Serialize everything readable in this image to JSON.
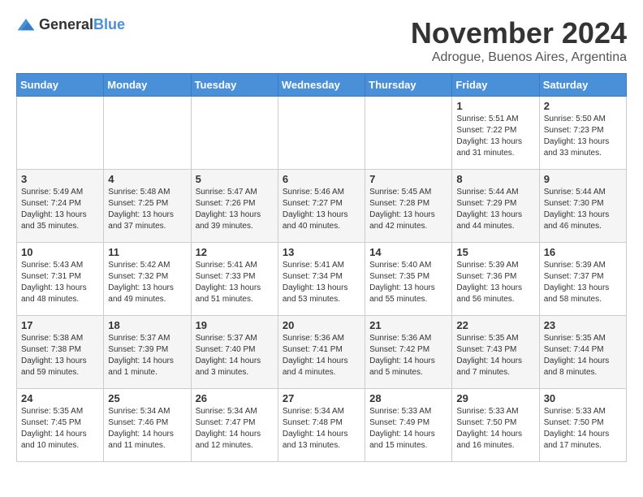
{
  "logo": {
    "general": "General",
    "blue": "Blue"
  },
  "title": {
    "month": "November 2024",
    "location": "Adrogue, Buenos Aires, Argentina"
  },
  "weekdays": [
    "Sunday",
    "Monday",
    "Tuesday",
    "Wednesday",
    "Thursday",
    "Friday",
    "Saturday"
  ],
  "weeks": [
    [
      {
        "day": "",
        "info": ""
      },
      {
        "day": "",
        "info": ""
      },
      {
        "day": "",
        "info": ""
      },
      {
        "day": "",
        "info": ""
      },
      {
        "day": "",
        "info": ""
      },
      {
        "day": "1",
        "info": "Sunrise: 5:51 AM\nSunset: 7:22 PM\nDaylight: 13 hours\nand 31 minutes."
      },
      {
        "day": "2",
        "info": "Sunrise: 5:50 AM\nSunset: 7:23 PM\nDaylight: 13 hours\nand 33 minutes."
      }
    ],
    [
      {
        "day": "3",
        "info": "Sunrise: 5:49 AM\nSunset: 7:24 PM\nDaylight: 13 hours\nand 35 minutes."
      },
      {
        "day": "4",
        "info": "Sunrise: 5:48 AM\nSunset: 7:25 PM\nDaylight: 13 hours\nand 37 minutes."
      },
      {
        "day": "5",
        "info": "Sunrise: 5:47 AM\nSunset: 7:26 PM\nDaylight: 13 hours\nand 39 minutes."
      },
      {
        "day": "6",
        "info": "Sunrise: 5:46 AM\nSunset: 7:27 PM\nDaylight: 13 hours\nand 40 minutes."
      },
      {
        "day": "7",
        "info": "Sunrise: 5:45 AM\nSunset: 7:28 PM\nDaylight: 13 hours\nand 42 minutes."
      },
      {
        "day": "8",
        "info": "Sunrise: 5:44 AM\nSunset: 7:29 PM\nDaylight: 13 hours\nand 44 minutes."
      },
      {
        "day": "9",
        "info": "Sunrise: 5:44 AM\nSunset: 7:30 PM\nDaylight: 13 hours\nand 46 minutes."
      }
    ],
    [
      {
        "day": "10",
        "info": "Sunrise: 5:43 AM\nSunset: 7:31 PM\nDaylight: 13 hours\nand 48 minutes."
      },
      {
        "day": "11",
        "info": "Sunrise: 5:42 AM\nSunset: 7:32 PM\nDaylight: 13 hours\nand 49 minutes."
      },
      {
        "day": "12",
        "info": "Sunrise: 5:41 AM\nSunset: 7:33 PM\nDaylight: 13 hours\nand 51 minutes."
      },
      {
        "day": "13",
        "info": "Sunrise: 5:41 AM\nSunset: 7:34 PM\nDaylight: 13 hours\nand 53 minutes."
      },
      {
        "day": "14",
        "info": "Sunrise: 5:40 AM\nSunset: 7:35 PM\nDaylight: 13 hours\nand 55 minutes."
      },
      {
        "day": "15",
        "info": "Sunrise: 5:39 AM\nSunset: 7:36 PM\nDaylight: 13 hours\nand 56 minutes."
      },
      {
        "day": "16",
        "info": "Sunrise: 5:39 AM\nSunset: 7:37 PM\nDaylight: 13 hours\nand 58 minutes."
      }
    ],
    [
      {
        "day": "17",
        "info": "Sunrise: 5:38 AM\nSunset: 7:38 PM\nDaylight: 13 hours\nand 59 minutes."
      },
      {
        "day": "18",
        "info": "Sunrise: 5:37 AM\nSunset: 7:39 PM\nDaylight: 14 hours\nand 1 minute."
      },
      {
        "day": "19",
        "info": "Sunrise: 5:37 AM\nSunset: 7:40 PM\nDaylight: 14 hours\nand 3 minutes."
      },
      {
        "day": "20",
        "info": "Sunrise: 5:36 AM\nSunset: 7:41 PM\nDaylight: 14 hours\nand 4 minutes."
      },
      {
        "day": "21",
        "info": "Sunrise: 5:36 AM\nSunset: 7:42 PM\nDaylight: 14 hours\nand 5 minutes."
      },
      {
        "day": "22",
        "info": "Sunrise: 5:35 AM\nSunset: 7:43 PM\nDaylight: 14 hours\nand 7 minutes."
      },
      {
        "day": "23",
        "info": "Sunrise: 5:35 AM\nSunset: 7:44 PM\nDaylight: 14 hours\nand 8 minutes."
      }
    ],
    [
      {
        "day": "24",
        "info": "Sunrise: 5:35 AM\nSunset: 7:45 PM\nDaylight: 14 hours\nand 10 minutes."
      },
      {
        "day": "25",
        "info": "Sunrise: 5:34 AM\nSunset: 7:46 PM\nDaylight: 14 hours\nand 11 minutes."
      },
      {
        "day": "26",
        "info": "Sunrise: 5:34 AM\nSunset: 7:47 PM\nDaylight: 14 hours\nand 12 minutes."
      },
      {
        "day": "27",
        "info": "Sunrise: 5:34 AM\nSunset: 7:48 PM\nDaylight: 14 hours\nand 13 minutes."
      },
      {
        "day": "28",
        "info": "Sunrise: 5:33 AM\nSunset: 7:49 PM\nDaylight: 14 hours\nand 15 minutes."
      },
      {
        "day": "29",
        "info": "Sunrise: 5:33 AM\nSunset: 7:50 PM\nDaylight: 14 hours\nand 16 minutes."
      },
      {
        "day": "30",
        "info": "Sunrise: 5:33 AM\nSunset: 7:50 PM\nDaylight: 14 hours\nand 17 minutes."
      }
    ]
  ]
}
